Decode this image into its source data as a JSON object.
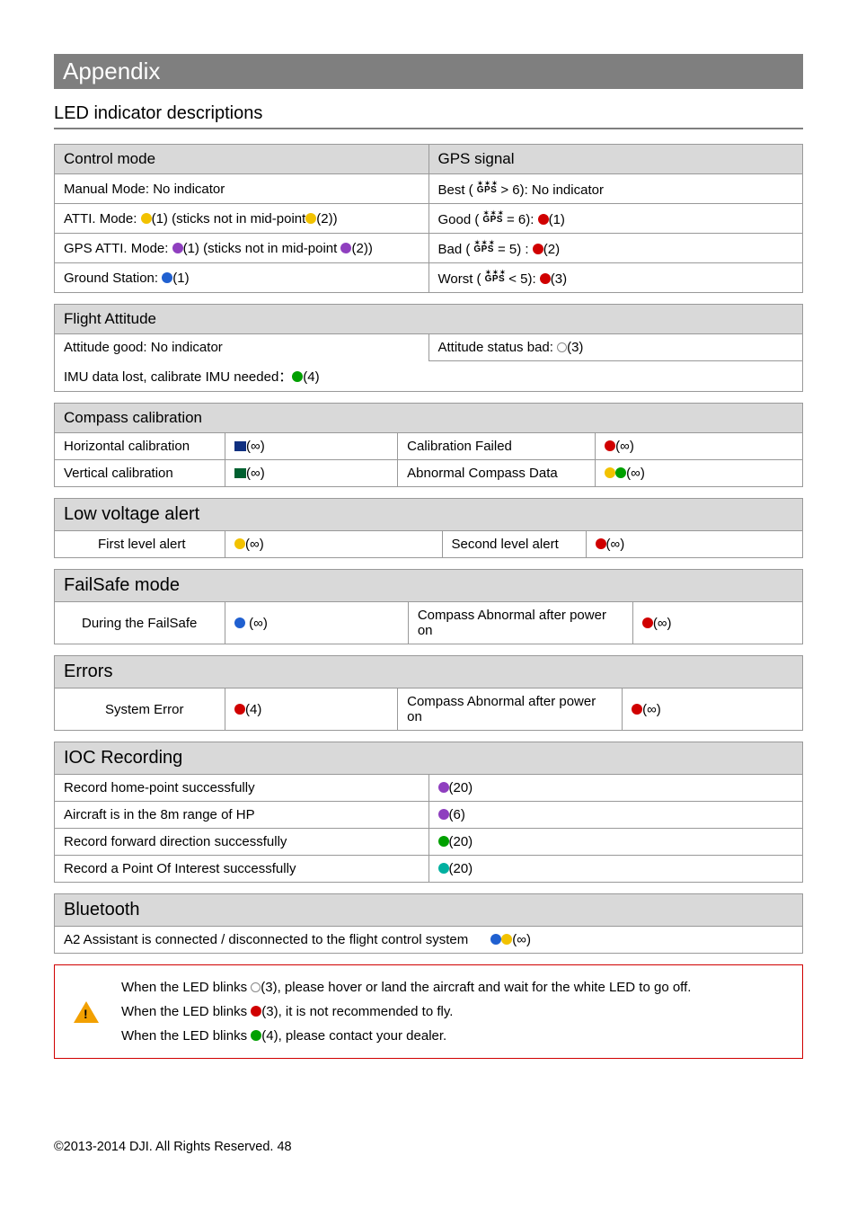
{
  "title": "Appendix",
  "subtitle": "LED indicator descriptions",
  "control_mode": {
    "header": "Control mode",
    "rows": {
      "manual": "Manual Mode: No indicator",
      "atti_a": "ATTI. Mode:  ",
      "atti_b": "(1) (sticks not in mid-point",
      "atti_c": "(2))",
      "gps_a": "GPS ATTI. Mode:  ",
      "gps_b": "(1) (sticks not in mid-point ",
      "gps_c": "(2))",
      "ground_a": "Ground Station:  ",
      "ground_b": "(1)"
    }
  },
  "gps_signal": {
    "header": "GPS signal",
    "rows": {
      "best_a": "Best (",
      "best_b": "> 6): No indicator",
      "good_a": "Good (",
      "good_b": "= 6):  ",
      "good_c": "(1)",
      "bad_a": "Bad (",
      "bad_b": "= 5) :   ",
      "bad_c": "(2)",
      "worst_a": "Worst (",
      "worst_b": "< 5):  ",
      "worst_c": "(3)"
    }
  },
  "flight_attitude": {
    "header": "Flight Attitude",
    "att_good": "Attitude good: No indicator",
    "att_bad_a": "Attitude status bad:  ",
    "att_bad_b": "(3)",
    "imu_a": "IMU data lost, calibrate IMU needed：",
    "imu_b": "(4)"
  },
  "compass": {
    "header": "Compass calibration",
    "horiz": "Horizontal calibration",
    "vert": "Vertical calibration",
    "fail": "Calibration Failed",
    "abn": "Abnormal Compass Data",
    "inf": "(∞)"
  },
  "low_voltage": {
    "header": "Low voltage alert",
    "first": "First level alert",
    "second": "Second level alert",
    "inf": "(∞)"
  },
  "failsafe": {
    "header": "FailSafe mode",
    "during": "During the FailSafe",
    "abn": "Compass Abnormal after power on",
    "inf": "(∞)",
    "inf2": " (∞)"
  },
  "errors": {
    "header": "Errors",
    "sys": "System Error",
    "sys_n": "(4)",
    "abn": "Compass Abnormal after power on",
    "inf": "(∞)"
  },
  "ioc": {
    "header": "IOC Recording",
    "r1": "Record home-point successfully",
    "r1n": "(20)",
    "r2": "Aircraft is in the 8m range of HP",
    "r2n": "(6)",
    "r3": "Record forward direction successfully",
    "r3n": "(20)",
    "r4": "Record a Point Of Interest successfully",
    "r4n": "(20)"
  },
  "bluetooth": {
    "header": "Bluetooth",
    "text": "A2 Assistant is connected / disconnected to the flight control system",
    "inf": "(∞)"
  },
  "warnings": {
    "w1a": "When the LED blinks  ",
    "w1b": "(3), please hover or land the aircraft and wait for the white LED to go off.",
    "w2a": "When the LED blinks  ",
    "w2b": "(3), it is not recommended to fly.",
    "w3a": "When the LED blinks  ",
    "w3b": "(4), please contact your dealer."
  },
  "gps_label": "GPS",
  "footer": "©2013-2014 DJI. All Rights Reserved.    48"
}
